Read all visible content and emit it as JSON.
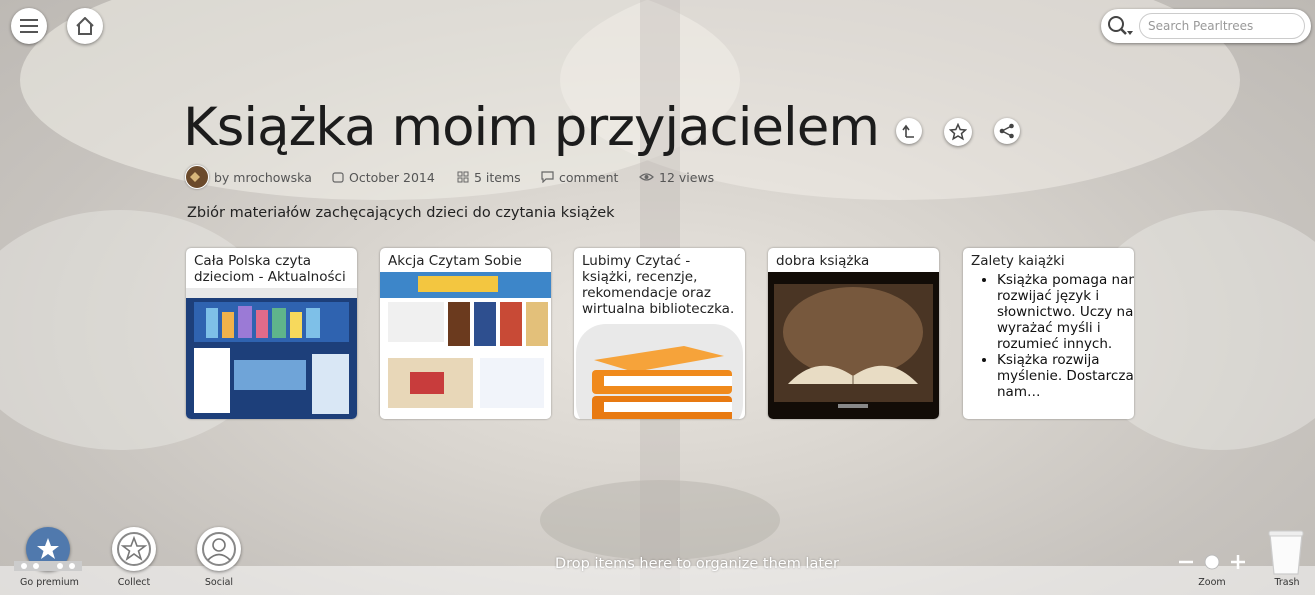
{
  "header": {
    "search_placeholder": "Search Pearltrees"
  },
  "collection": {
    "title": "Książka moim przyjacielem",
    "author": "by mrochowska",
    "date": "October 2014",
    "items_count": "5 items",
    "comment": "comment",
    "views": "12 views",
    "description": "Zbiór materiałów zachęcających dzieci do czytania książek"
  },
  "cards": [
    {
      "title": "Cała Polska czyta dzieciom - Aktualności",
      "thumb": "website-screenshot-blue"
    },
    {
      "title": "Akcja Czytam Sobie",
      "thumb": "website-screenshot-books"
    },
    {
      "title": "Lubimy Czytać - książki, recenzje, rekomendacje oraz wirtualna biblioteczka.",
      "thumb": "orange-books-icon"
    },
    {
      "title": "dobra książka",
      "thumb": "open-book-photo"
    },
    {
      "title": "Zalety kaiążki",
      "bullets": [
        "Książka pomaga nam rozwijać język i słownictwo. Uczy nas wyrażać myśli i rozumieć innych.",
        "Książka rozwija myślenie. Dostarcza nam…"
      ]
    }
  ],
  "footer": {
    "go_premium": "Go premium",
    "collect": "Collect",
    "social": "Social",
    "drop_text": "Drop items here to organize them later",
    "zoom": "Zoom",
    "trash": "Trash"
  },
  "colors": {
    "accent_blue": "#3b6ea8",
    "orange_books": "#f08a1c"
  }
}
